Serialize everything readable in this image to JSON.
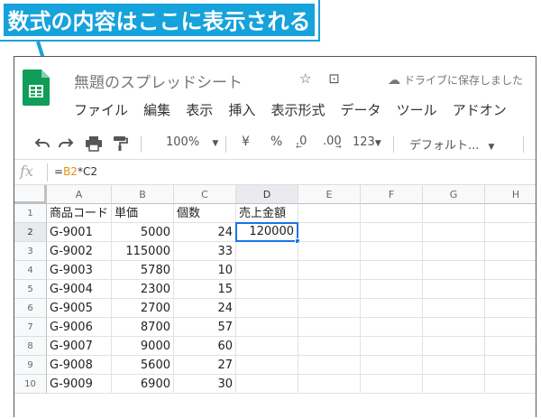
{
  "callout": {
    "text": "数式の内容はここに表示される"
  },
  "window": {
    "doc_title": "無題のスプレッドシート",
    "save_status": "ドライブに保存しました",
    "title_icons": [
      "star-icon",
      "folder-move-icon",
      "cloud-check-icon"
    ]
  },
  "menu": [
    "ファイル",
    "編集",
    "表示",
    "挿入",
    "表示形式",
    "データ",
    "ツール",
    "アドオン"
  ],
  "toolbar": {
    "zoom": "100%",
    "currency": "¥",
    "percent": "%",
    "decrease_decimal": ".0",
    "increase_decimal": ".00",
    "number_format": "123",
    "font": "デフォルト..."
  },
  "formula_bar": {
    "fx": "fx",
    "prefix": "=",
    "ref1": "B2",
    "op": "*",
    "ref2": "C2"
  },
  "sheet": {
    "columns": [
      "A",
      "B",
      "C",
      "D",
      "E",
      "F",
      "G",
      "H"
    ],
    "rows": [
      "1",
      "2",
      "3",
      "4",
      "5",
      "6",
      "7",
      "8",
      "9",
      "10"
    ],
    "selected_cell": "D2",
    "cells": [
      [
        "商品コード",
        "単価",
        "個数",
        "売上金額"
      ],
      [
        "G-9001",
        "5000",
        "24",
        "120000"
      ],
      [
        "G-9002",
        "115000",
        "33",
        ""
      ],
      [
        "G-9003",
        "5780",
        "10",
        ""
      ],
      [
        "G-9004",
        "2300",
        "15",
        ""
      ],
      [
        "G-9005",
        "2700",
        "24",
        ""
      ],
      [
        "G-9006",
        "8700",
        "57",
        ""
      ],
      [
        "G-9007",
        "9000",
        "60",
        ""
      ],
      [
        "G-9008",
        "5600",
        "27",
        ""
      ],
      [
        "G-9009",
        "6900",
        "30",
        ""
      ]
    ]
  },
  "colors": {
    "callout": "#16a2db",
    "selection": "#1a73e8",
    "sheets_green": "#0f9d58",
    "formula_ref": "#e48f0c"
  }
}
